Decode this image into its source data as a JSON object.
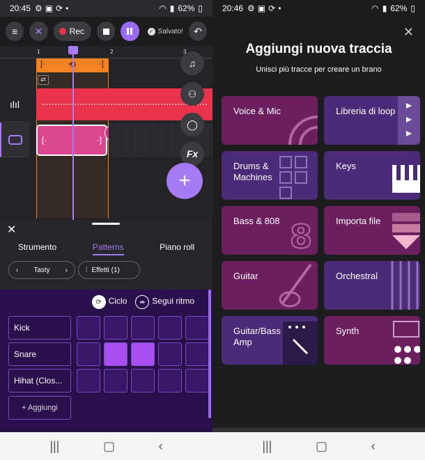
{
  "left": {
    "status": {
      "time": "20:45",
      "battery": "62%"
    },
    "toolbar": {
      "menu_icon": "menu-icon",
      "rec_label": "Rec",
      "saved_label": "Salvato!"
    },
    "ruler": {
      "marks": [
        "1",
        "2",
        "3"
      ]
    },
    "side_buttons": [
      "music-note-icon",
      "collaborators-icon",
      "comment-icon",
      "Fx"
    ],
    "panel": {
      "tabs": [
        "Strumento",
        "Patterns",
        "Piano roll"
      ],
      "active_tab": "Patterns",
      "kit_selector": "Tasty",
      "effects_label": "Effetti (1)",
      "drum_header": {
        "loop_label": "Ciclo",
        "follow_label": "Segui ritmo"
      },
      "rows": [
        {
          "label": "Kick",
          "cells": [
            false,
            false,
            false,
            false,
            false
          ]
        },
        {
          "label": "Snare",
          "cells": [
            false,
            true,
            true,
            false,
            false
          ]
        },
        {
          "label": "Hihat (Clos...",
          "cells": [
            false,
            false,
            false,
            false,
            false
          ]
        }
      ],
      "add_label": "+ Aggiungi"
    }
  },
  "right": {
    "status": {
      "time": "20:46",
      "battery": "62%"
    },
    "title": "Aggiungi nuova traccia",
    "subtitle": "Unisci più tracce per creare un brano",
    "cards": [
      {
        "label": "Voice & Mic",
        "color": "#6c1f5f"
      },
      {
        "label": "Libreria di loop",
        "color": "#4b2a78"
      },
      {
        "label": "Drums & Machines",
        "color": "#4b2a78"
      },
      {
        "label": "Keys",
        "color": "#4b2a78"
      },
      {
        "label": "Bass & 808",
        "color": "#6c1f5f"
      },
      {
        "label": "Importa file",
        "color": "#6c1f5f"
      },
      {
        "label": "Guitar",
        "color": "#6c1f5f"
      },
      {
        "label": "Orchestral",
        "color": "#4b2a78"
      },
      {
        "label": "Guitar/Bass Amp",
        "color": "#4b2a78"
      },
      {
        "label": "Synth",
        "color": "#6c1f5f"
      }
    ]
  }
}
